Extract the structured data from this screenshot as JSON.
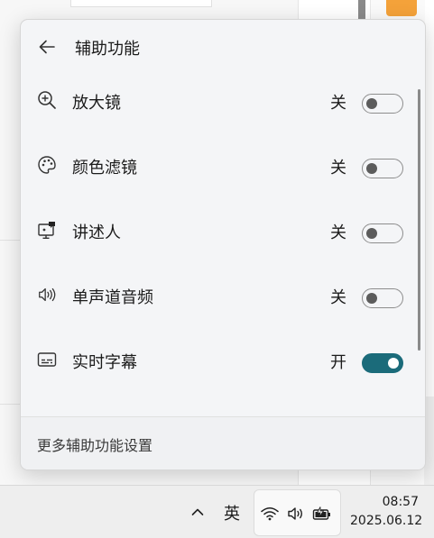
{
  "panel": {
    "title": "辅助功能",
    "footer_link": "更多辅助功能设置"
  },
  "items": [
    {
      "label": "放大镜",
      "state": "关",
      "on": false,
      "icon": "magnifier-icon"
    },
    {
      "label": "颜色滤镜",
      "state": "关",
      "on": false,
      "icon": "palette-icon"
    },
    {
      "label": "讲述人",
      "state": "关",
      "on": false,
      "icon": "narrator-icon"
    },
    {
      "label": "单声道音频",
      "state": "关",
      "on": false,
      "icon": "mono-audio-icon"
    },
    {
      "label": "实时字幕",
      "state": "开",
      "on": true,
      "icon": "captions-icon"
    }
  ],
  "taskbar": {
    "ime": "英",
    "time": "08:57",
    "date": "2025.06.12"
  },
  "colors": {
    "accent": "#1b6b7a",
    "panel_bg": "#f4f5f7"
  }
}
